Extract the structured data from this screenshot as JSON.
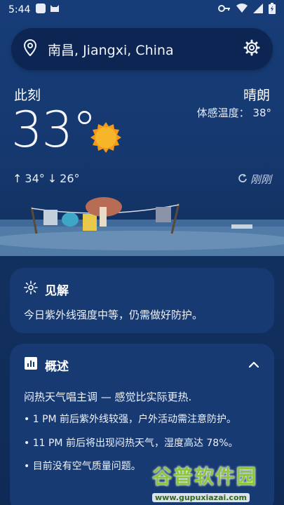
{
  "status_bar": {
    "time": "5:44"
  },
  "location": {
    "text": "南昌, Jiangxi, China"
  },
  "current": {
    "label": "此刻",
    "temperature": "33°",
    "condition": "晴朗",
    "feels_like": "体感温度： 38°",
    "high": "34°",
    "low": "26°",
    "updated": "刚刚"
  },
  "insights": {
    "title": "见解",
    "text": "今日紫外线强度中等，仍需做好防护。"
  },
  "overview": {
    "title": "概述",
    "summary": "闷热天气唱主调 — 感觉比实际更热.",
    "bullets": [
      "• 1 PM 前后紫外线较强，户外活动需注意防护。",
      "• 11 PM 前后将出现闷热天气，湿度高达 78%。",
      "• 目前没有空气质量问题。"
    ]
  },
  "watermark": {
    "title": "谷普软件园",
    "url": "www.gupuxiazai.com"
  }
}
